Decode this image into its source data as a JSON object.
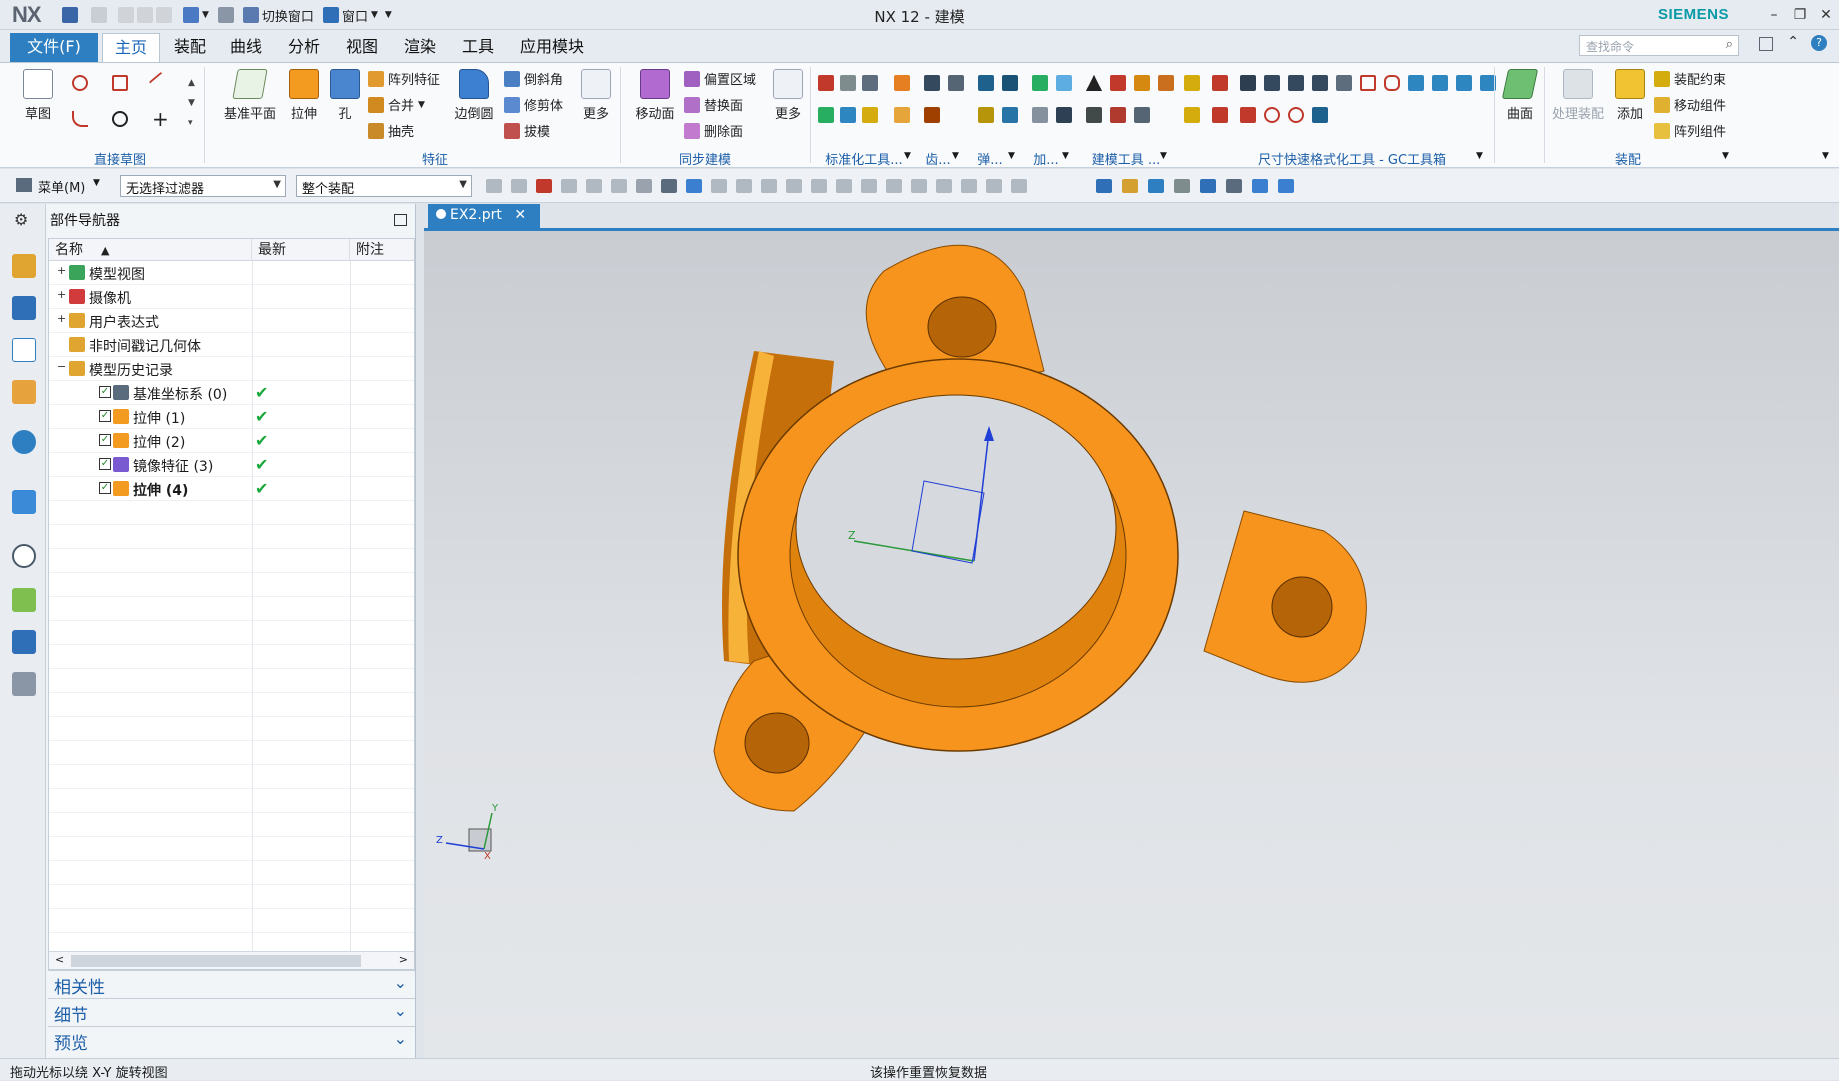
{
  "titlebar": {
    "logo": "NX",
    "app_title": "NX 12 - 建模",
    "brand": "SIEMENS",
    "switch_window": "切换窗口",
    "window_menu": "窗口"
  },
  "tabs": [
    "文件(F)",
    "主页",
    "装配",
    "曲线",
    "分析",
    "视图",
    "渲染",
    "工具",
    "应用模块"
  ],
  "search": {
    "placeholder": "查找命令"
  },
  "ribbon": {
    "sketch": "草图",
    "datum_plane": "基准平面",
    "extrude": "拉伸",
    "hole": "孔",
    "pattern_feature": "阵列特征",
    "unite": "合并",
    "shell": "抽壳",
    "edge_blend": "边倒圆",
    "chamfer": "倒斜角",
    "trim_body": "修剪体",
    "draft": "拔模",
    "more1": "更多",
    "move_face": "移动面",
    "offset_region": "偏置区域",
    "replace_face": "替换面",
    "delete_face": "删除面",
    "more2": "更多",
    "surface": "曲面",
    "process_assembly": "处理装配",
    "add": "添加",
    "assembly_constraints": "装配约束",
    "move_component": "移动组件",
    "pattern_component": "阵列组件",
    "groups": {
      "direct_sketch": "直接草图",
      "feature": "特征",
      "sync_modeling": "同步建模",
      "standard_tools": "标准化工具...",
      "gear": "齿...",
      "spring": "弹...",
      "machining": "加...",
      "modeling_tools": "建模工具 ...",
      "dimension_tools": "尺寸快速格式化工具 - GC工具箱",
      "assembly": "装配"
    }
  },
  "cmdbar": {
    "menu": "菜单(M)",
    "filter": "无选择过滤器",
    "scope": "整个装配"
  },
  "navigator": {
    "title": "部件导航器",
    "columns": [
      "名称",
      "最新",
      "附注"
    ],
    "rows": [
      {
        "label": "模型视图",
        "level": 0,
        "expander": "+",
        "check": false,
        "latest": ""
      },
      {
        "label": "摄像机",
        "level": 0,
        "expander": "+",
        "check": false,
        "latest": ""
      },
      {
        "label": "用户表达式",
        "level": 0,
        "expander": "+",
        "check": false,
        "latest": ""
      },
      {
        "label": "非时间戳记几何体",
        "level": 0,
        "expander": "",
        "check": false,
        "latest": ""
      },
      {
        "label": "模型历史记录",
        "level": 0,
        "expander": "−",
        "check": false,
        "latest": ""
      },
      {
        "label": "基准坐标系 (0)",
        "level": 1,
        "expander": "",
        "check": true,
        "latest": "✔"
      },
      {
        "label": "拉伸 (1)",
        "level": 1,
        "expander": "",
        "check": true,
        "latest": "✔"
      },
      {
        "label": "拉伸 (2)",
        "level": 1,
        "expander": "",
        "check": true,
        "latest": "✔"
      },
      {
        "label": "镜像特征 (3)",
        "level": 1,
        "expander": "",
        "check": true,
        "latest": "✔"
      },
      {
        "label": "拉伸 (4)",
        "level": 1,
        "expander": "",
        "check": true,
        "latest": "✔",
        "bold": true
      }
    ],
    "panels": [
      "相关性",
      "细节",
      "预览"
    ]
  },
  "document_tab": "EX2.prt",
  "status": {
    "left": "拖动光标以绕 X-Y 旋转视图",
    "center": "该操作重置恢复数据"
  },
  "colors": {
    "accent": "#2e7fc1",
    "part_orange": "#f7941d",
    "brand_teal": "#0a9aa6"
  }
}
